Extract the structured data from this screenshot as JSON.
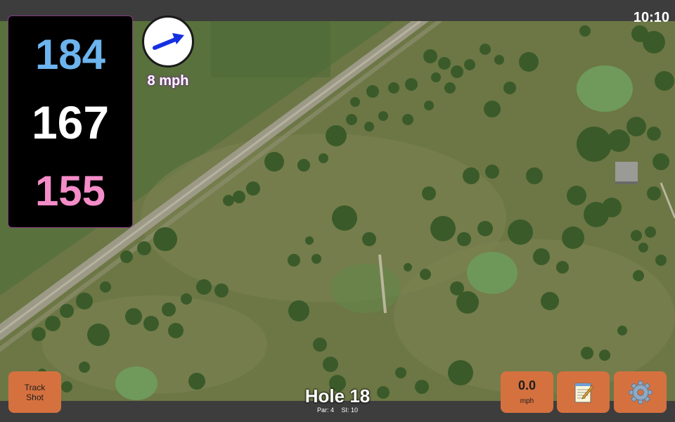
{
  "status": {
    "time": "10:10"
  },
  "distances": {
    "back": "184",
    "middle": "167",
    "front": "155"
  },
  "wind": {
    "speed_label": "8 mph",
    "icon": "wind-direction-arrow-icon",
    "arrow_color": "#1530e0"
  },
  "track_shot": {
    "line1": "Track",
    "line2": "Shot"
  },
  "speed": {
    "value": "0.0",
    "unit": "mph"
  },
  "notes": {
    "icon": "notepad-icon"
  },
  "settings": {
    "icon": "gear-icon"
  },
  "hole": {
    "title": "Hole 18",
    "par": "Par: 4",
    "si": "SI: 10"
  },
  "colors": {
    "back_distance": "#6db4ee",
    "middle_distance": "#ffffff",
    "front_distance": "#f48cc8",
    "button": "#d5713f",
    "bars": "#3d3d3d"
  }
}
